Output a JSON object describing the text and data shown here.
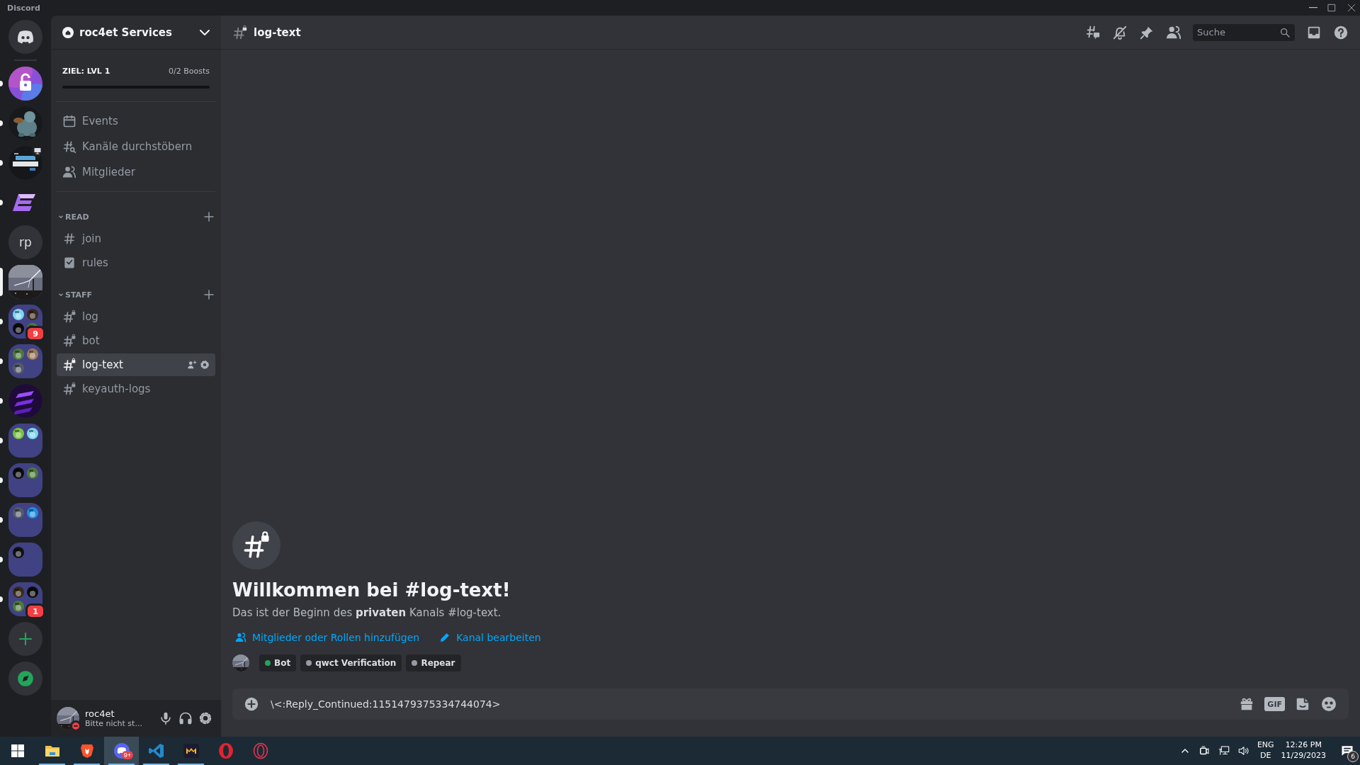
{
  "window": {
    "title": "Discord"
  },
  "servers": [
    {
      "kind": "home",
      "unread": false,
      "selected": false
    },
    {
      "kind": "picture",
      "unread": true,
      "selected": false
    },
    {
      "kind": "picture",
      "unread": true,
      "selected": false
    },
    {
      "kind": "picture",
      "unread": true,
      "selected": false,
      "streaming": true
    },
    {
      "kind": "picture",
      "unread": true,
      "selected": false
    },
    {
      "kind": "text",
      "label": "rp",
      "unread": false,
      "selected": false
    },
    {
      "kind": "picture",
      "selected": true
    },
    {
      "kind": "folder",
      "unread": true,
      "selected": false,
      "badge": "9",
      "servers": [
        {
          "kind": "picture"
        },
        {
          "kind": "picture"
        },
        {
          "kind": "picture"
        },
        {
          "kind": "picture"
        }
      ]
    },
    {
      "kind": "folder",
      "unread": true,
      "selected": false,
      "servers": [
        {
          "kind": "picture"
        },
        {
          "kind": "picture"
        },
        {
          "kind": "picture"
        }
      ]
    },
    {
      "kind": "picture",
      "unread": true,
      "selected": false
    },
    {
      "kind": "folder",
      "unread": true,
      "selected": false,
      "servers": [
        {
          "kind": "picture"
        },
        {
          "kind": "picture"
        }
      ]
    },
    {
      "kind": "folder",
      "unread": true,
      "selected": false,
      "servers": [
        {
          "kind": "picture"
        },
        {
          "kind": "picture"
        }
      ]
    },
    {
      "kind": "folder",
      "unread": true,
      "selected": false,
      "servers": [
        {
          "kind": "picture"
        },
        {
          "kind": "picture"
        }
      ]
    },
    {
      "kind": "folder",
      "unread": true,
      "selected": false,
      "servers": [
        {
          "kind": "picture"
        }
      ]
    },
    {
      "kind": "folder",
      "unread": true,
      "selected": false,
      "badge": "1",
      "servers": [
        {
          "kind": "picture"
        },
        {
          "kind": "picture"
        },
        {
          "kind": "picture"
        }
      ]
    },
    {
      "kind": "add",
      "unread": false,
      "selected": false
    },
    {
      "kind": "explore",
      "unread": false,
      "selected": false
    }
  ],
  "server": {
    "name": "roc4et Services"
  },
  "boost": {
    "goal": "ZIEL: LVL 1",
    "count": "0/2 Boosts",
    "level": 0
  },
  "nav": [
    {
      "kind": "events",
      "label": "Events"
    },
    {
      "kind": "browse",
      "label": "Kanäle durchstöbern"
    },
    {
      "kind": "members",
      "label": "Mitglieder"
    }
  ],
  "categories": [
    {
      "name": "READ",
      "expanded": true,
      "channels": [
        {
          "kind": "text",
          "name": "join",
          "selected": false
        },
        {
          "kind": "rules",
          "name": "rules",
          "selected": false
        }
      ]
    },
    {
      "name": "STAFF",
      "expanded": true,
      "channels": [
        {
          "kind": "private",
          "name": "log",
          "selected": false
        },
        {
          "kind": "private",
          "name": "bot",
          "selected": false
        },
        {
          "kind": "private",
          "name": "log-text",
          "selected": true
        },
        {
          "kind": "private",
          "name": "keyauth-logs",
          "selected": false
        }
      ]
    }
  ],
  "user": {
    "name": "roc4et",
    "status": "Bitte nicht st...",
    "do_not_disturb": true
  },
  "header": {
    "channel": "log-text",
    "search": {
      "placeholder": "Suche"
    }
  },
  "welcome": {
    "title": "Willkommen bei #log-text!",
    "description": "Das ist der Beginn des **privaten** Kanals #log-text.",
    "actions": [
      {
        "kind": "add-members",
        "label": "Mitglieder oder Rollen hinzufügen"
      },
      {
        "kind": "edit",
        "label": "Kanal bearbeiten"
      }
    ],
    "roles": [
      {
        "name": "Bot",
        "color": "#23a55a"
      },
      {
        "name": "qwct Verification",
        "color": "#949ba4"
      },
      {
        "name": "Repear",
        "color": "#949ba4"
      }
    ]
  },
  "composer": {
    "value": "\\<:Reply_Continued:1151479375334744074>",
    "gif": "GIF"
  },
  "taskbar": {
    "apps": [
      {
        "kind": "explorer",
        "running": true,
        "active": false
      },
      {
        "kind": "brave",
        "running": true,
        "active": false
      },
      {
        "kind": "discord",
        "running": true,
        "active": true,
        "badge": "9+"
      },
      {
        "kind": "vscode",
        "running": true,
        "active": false
      },
      {
        "kind": "mail",
        "running": true,
        "active": false
      },
      {
        "kind": "opera",
        "running": false,
        "active": false
      },
      {
        "kind": "opera-gx",
        "running": false,
        "active": false
      }
    ],
    "tray": {
      "language": "ENG",
      "layout": "DE",
      "time": "12:26 PM",
      "date": "11/29/2023",
      "notifications": "6"
    }
  }
}
